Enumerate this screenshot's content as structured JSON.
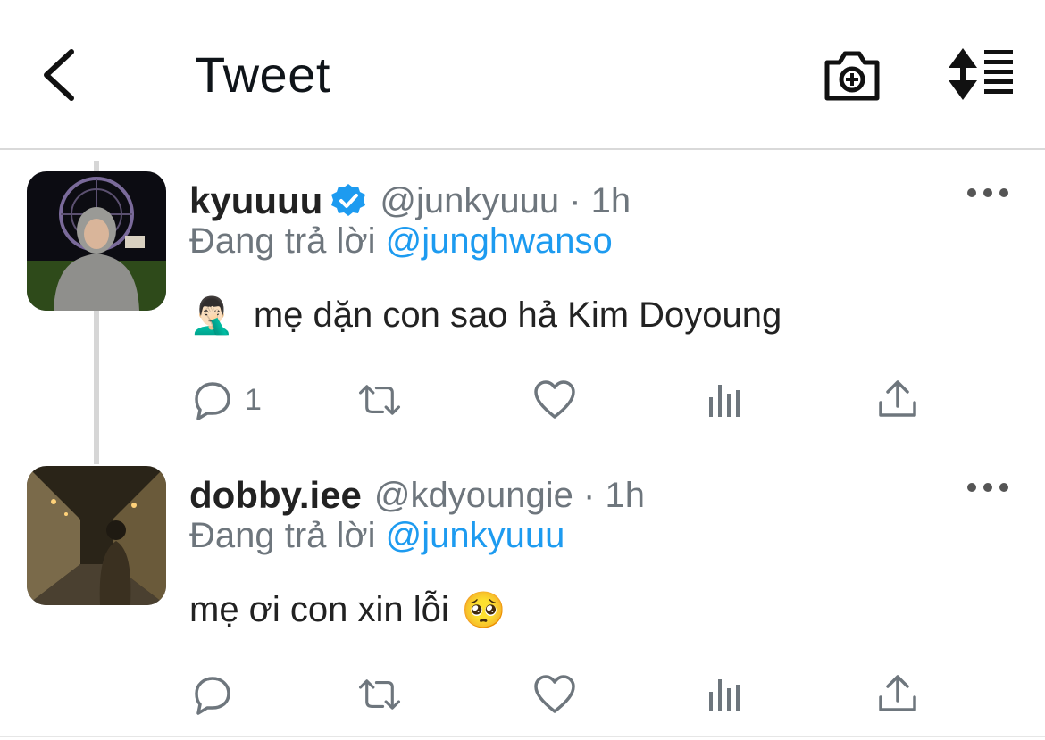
{
  "header": {
    "title": "Tweet",
    "back_icon": "chevron-left-icon",
    "camera_icon": "camera-add-icon",
    "sort_icon": "sort-order-icon"
  },
  "tweets": [
    {
      "display_name": "kyuuuu",
      "verified": true,
      "handle": "@junkyuuu",
      "separator": "·",
      "time": "1h",
      "reply_prefix": "Đang trả lời",
      "reply_to": "@junghwanso",
      "text": "mẹ dặn con sao hả Kim Doyoung",
      "lead_emoji": "🤦🏻‍♂️",
      "trail_emoji": "",
      "reply_count": "1",
      "retweet_count": "",
      "like_count": ""
    },
    {
      "display_name": "dobby.iee",
      "verified": false,
      "handle": "@kdyoungie",
      "separator": "·",
      "time": "1h",
      "reply_prefix": "Đang trả lời",
      "reply_to": "@junkyuuu",
      "text": "mẹ ơi con xin lỗi",
      "lead_emoji": "",
      "trail_emoji": "🥺",
      "reply_count": "",
      "retweet_count": "",
      "like_count": ""
    }
  ],
  "colors": {
    "accent": "#1d9bf0",
    "secondary_text": "#6e767d",
    "primary_text": "#222222",
    "icon": "#6e767d"
  }
}
